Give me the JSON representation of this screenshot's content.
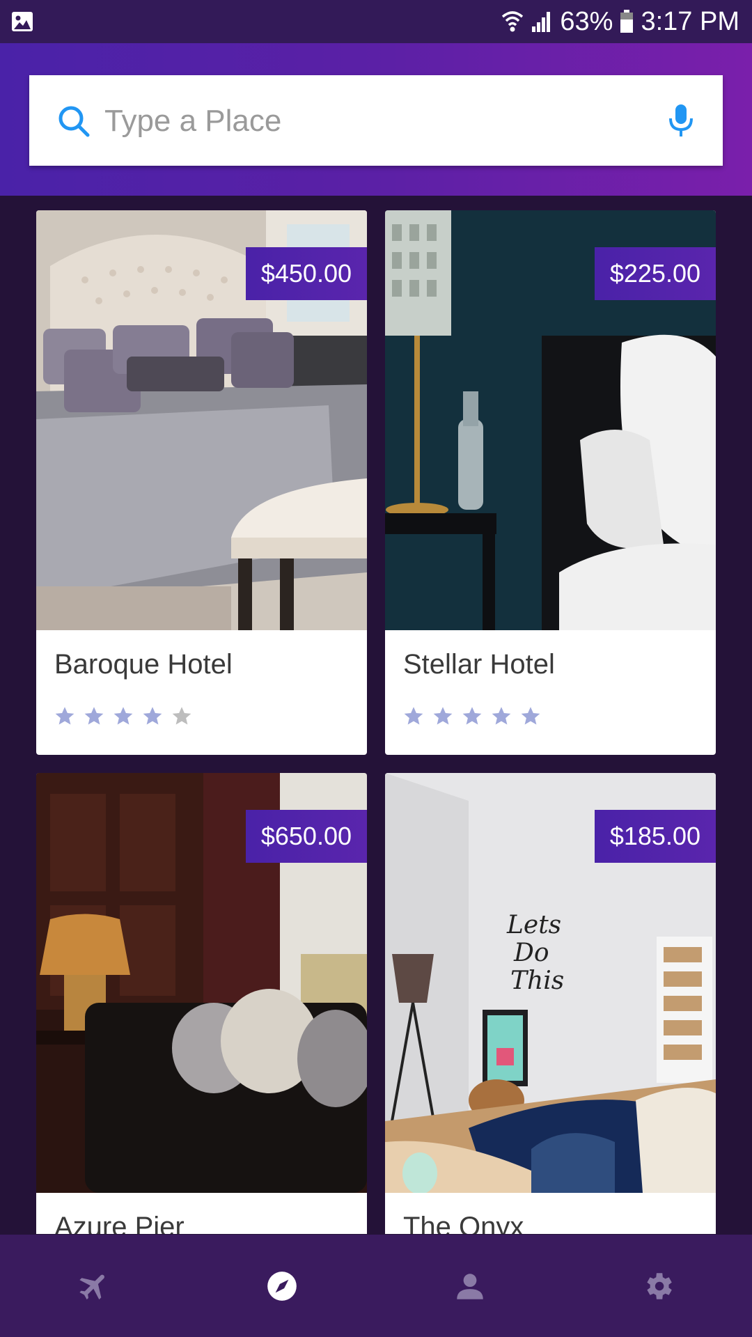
{
  "status_bar": {
    "battery": "63%",
    "time": "3:17 PM"
  },
  "search": {
    "placeholder": "Type a Place"
  },
  "hotels": [
    {
      "name": "Baroque Hotel",
      "price": "$450.00",
      "rating": 4,
      "max_rating": 5
    },
    {
      "name": "Stellar Hotel",
      "price": "$225.00",
      "rating": 5,
      "max_rating": 5
    },
    {
      "name": "Azure Pier",
      "price": "$650.00",
      "rating": null,
      "max_rating": 5
    },
    {
      "name": "The Onyx",
      "price": "$185.00",
      "rating": null,
      "max_rating": 5
    }
  ],
  "bottom_nav": {
    "items": [
      {
        "icon": "airplane-icon",
        "active": false
      },
      {
        "icon": "compass-icon",
        "active": true
      },
      {
        "icon": "person-icon",
        "active": false
      },
      {
        "icon": "gear-icon",
        "active": false
      }
    ]
  },
  "colors": {
    "header_gradient_start": "#4a22a8",
    "header_gradient_end": "#7a1fab",
    "background": "#241238",
    "accent_blue": "#2196f3",
    "star_filled": "#9fa8da",
    "star_empty": "#bdbdbd",
    "nav_bar": "#3a1b5e"
  }
}
